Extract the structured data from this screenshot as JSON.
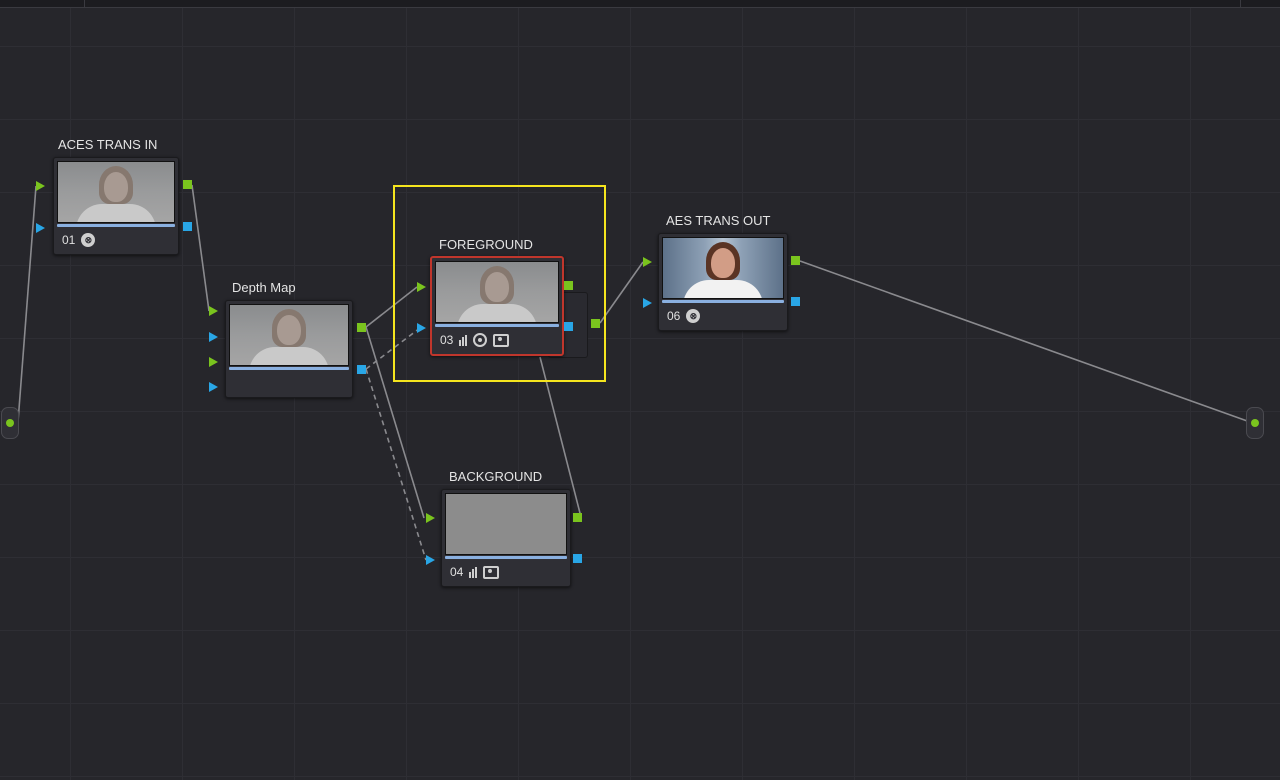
{
  "colors": {
    "background": "#26262b",
    "rgb_port": "#7ac41e",
    "alpha_port": "#29a6e6",
    "selection": "#f5e51e",
    "selected_node_border": "#c0362c"
  },
  "nodes": {
    "aces_trans_in": {
      "label": "ACES TRANS IN",
      "number": "01",
      "icons": [
        "aces-icon"
      ]
    },
    "depth_map": {
      "label": "Depth Map",
      "number": ""
    },
    "foreground": {
      "label": "FOREGROUND",
      "number": "03",
      "icons": [
        "bars-icon",
        "target-icon",
        "photo-icon"
      ],
      "selected": true
    },
    "aes_trans_out": {
      "label": "AES TRANS OUT",
      "number": "06",
      "icons": [
        "aces-icon"
      ]
    },
    "background": {
      "label": "BACKGROUND",
      "number": "04",
      "icons": [
        "bars-icon",
        "photo-icon"
      ]
    }
  },
  "icons": {
    "aces_glyph": "⊗"
  }
}
